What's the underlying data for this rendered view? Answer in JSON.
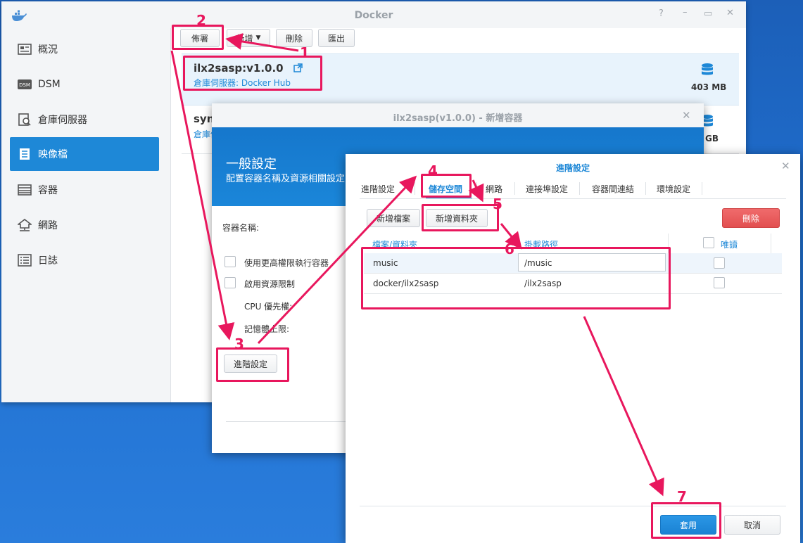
{
  "docker": {
    "title": "Docker",
    "sidebar": [
      {
        "label": "概況",
        "icon": "overview-icon"
      },
      {
        "label": "DSM",
        "icon": "dsm-icon"
      },
      {
        "label": "倉庫伺服器",
        "icon": "registry-icon"
      },
      {
        "label": "映像檔",
        "icon": "image-icon"
      },
      {
        "label": "容器",
        "icon": "container-icon"
      },
      {
        "label": "網路",
        "icon": "network-icon"
      },
      {
        "label": "日誌",
        "icon": "log-icon"
      }
    ],
    "toolbar": {
      "launch": "佈署",
      "add": "新增",
      "delete": "刪除",
      "export": "匯出"
    },
    "images": [
      {
        "name": "ilx2sasp:v1.0.0",
        "source": "倉庫伺服器: Docker Hub",
        "size": "403 MB"
      },
      {
        "name": "syn",
        "source": "倉庫伺",
        "size": "GB"
      }
    ]
  },
  "container_dialog": {
    "title": "ilx2sasp(v1.0.0) - 新增容器",
    "header_title": "一般設定",
    "header_subtitle": "配置容器名稱及資源相關設定",
    "container_name_label": "容器名稱:",
    "privileged_label": "使用更高權限執行容器",
    "resource_limit_label": "啟用資源限制",
    "cpu_label": "CPU 優先權:",
    "memory_label": "記憶體上限:",
    "advanced_button": "進階設定"
  },
  "advanced_dialog": {
    "title": "進階設定",
    "tabs": [
      "進階設定",
      "儲存空間",
      "網路",
      "連接埠設定",
      "容器間連結",
      "環境設定"
    ],
    "add_file": "新增檔案",
    "add_folder": "新增資料夾",
    "delete": "刪除",
    "columns": {
      "file": "檔案/資料夾",
      "mount": "掛載路徑",
      "readonly": "唯讀"
    },
    "rows": [
      {
        "file": "music",
        "mount": "/music"
      },
      {
        "file": "docker/ilx2sasp",
        "mount": "/ilx2sasp"
      }
    ],
    "apply": "套用",
    "cancel": "取消"
  },
  "annotations": [
    "1",
    "2",
    "3",
    "4",
    "5",
    "6",
    "7"
  ],
  "colors": {
    "accent": "#1e88d7",
    "annotation": "#e8175d",
    "danger": "#e9595a"
  }
}
